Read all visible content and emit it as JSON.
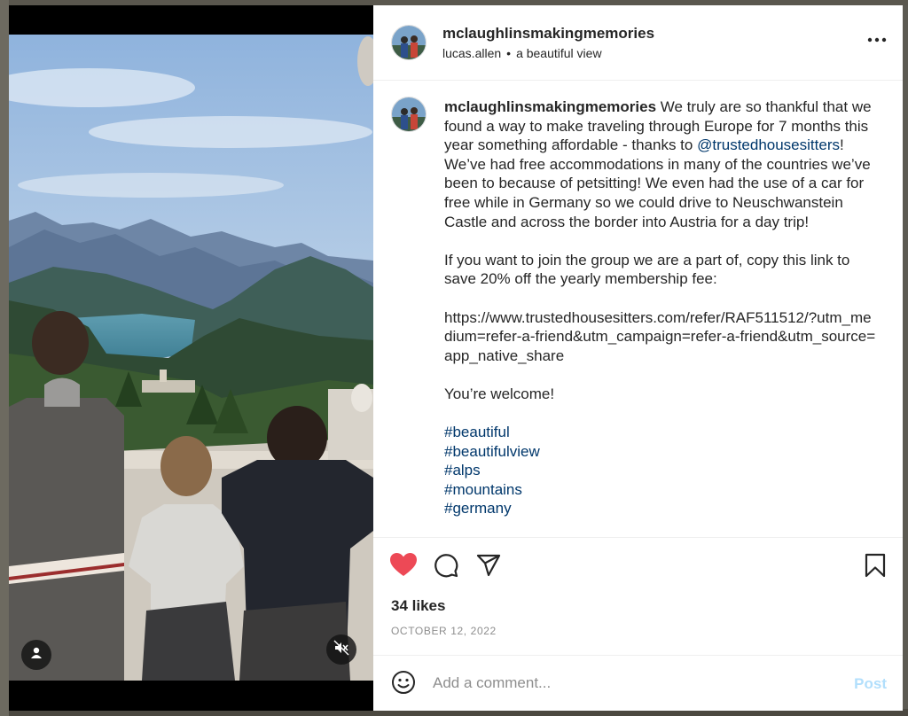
{
  "header": {
    "username": "mclaughlinsmakingmemories",
    "tagged_user": "lucas.allen",
    "separator": "•",
    "location": "a beautiful view",
    "more_icon": "more-horizontal-icon"
  },
  "caption": {
    "username": "mclaughlinsmakingmemories",
    "text_1": "We truly are so thankful that we found a way to make traveling through Europe for 7 months this year something affordable - thanks to",
    "mention": "@trustedhousesitters",
    "text_2": "! We’ve had free accommodations in many of the countries we’ve been to because of petsitting! We even had the use of a car for free while in Germany so we could drive to Neuschwanstein Castle and across the border into Austria for a day trip!",
    "paragraph_2": "If you want to join the group we are a part of, copy this link to save 20% off the yearly membership fee:",
    "paragraph_3": "https://www.trustedhousesitters.com/refer/RAF511512/?utm_medium=refer-a-friend&utm_campaign=refer-a-friend&utm_source=app_native_share",
    "paragraph_4": "You’re welcome!",
    "hashtags": [
      "#beautiful",
      "#beautifulview",
      "#alps",
      "#mountains",
      "#germany"
    ]
  },
  "actions": {
    "like_icon": "heart-filled-icon",
    "comment_icon": "comment-icon",
    "share_icon": "send-icon",
    "save_icon": "bookmark-icon",
    "likes": "34 likes",
    "date": "OCTOBER 12, 2022"
  },
  "comment": {
    "placeholder": "Add a comment...",
    "post_label": "Post",
    "emoji_icon": "smiley-icon"
  },
  "media": {
    "user_tag_icon": "person-icon",
    "mute_icon": "speaker-muted-icon"
  },
  "colors": {
    "like_red": "#ed4956",
    "link_blue": "#00376b",
    "post_disabled": "#b2dffc",
    "muted_text": "#8e8e8e"
  }
}
